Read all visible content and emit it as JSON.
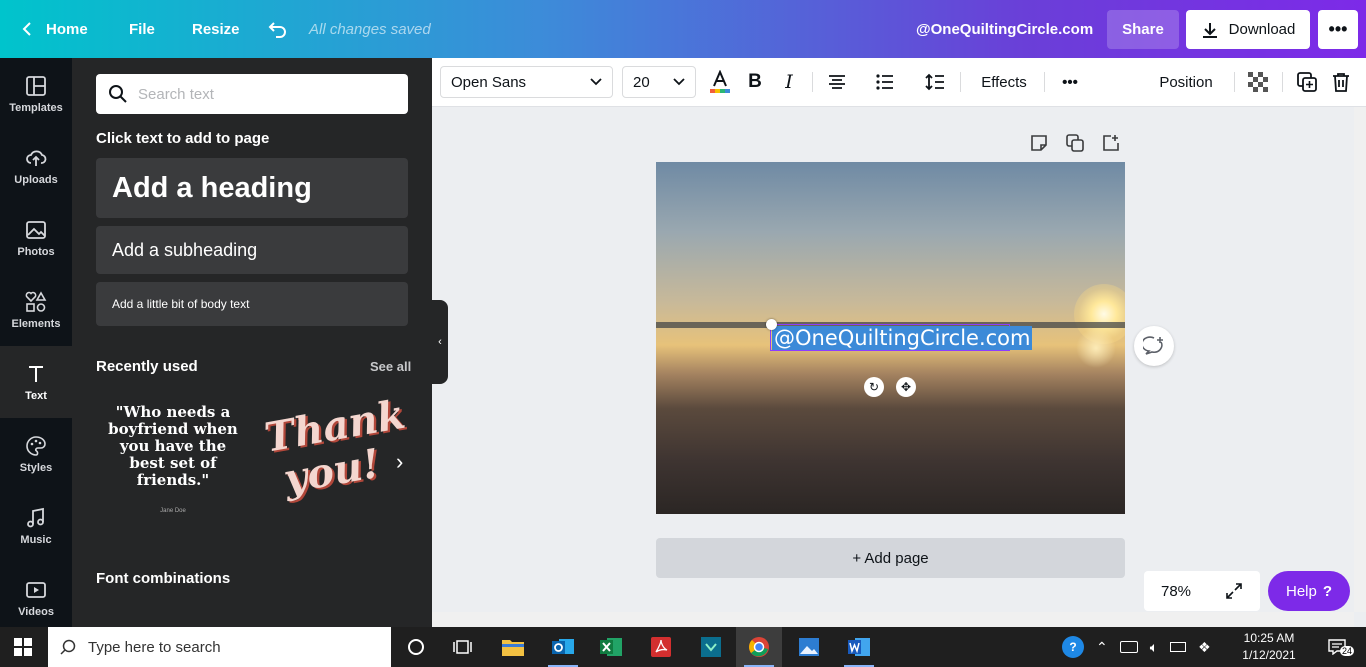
{
  "topbar": {
    "home": "Home",
    "file": "File",
    "resize": "Resize",
    "saved_status": "All changes saved",
    "site": "@OneQuiltingCircle.com",
    "share": "Share",
    "download": "Download",
    "more": "•••"
  },
  "rail": [
    {
      "label": "Templates",
      "icon": "templates-icon"
    },
    {
      "label": "Uploads",
      "icon": "upload-cloud-icon"
    },
    {
      "label": "Photos",
      "icon": "photo-icon"
    },
    {
      "label": "Elements",
      "icon": "shapes-icon"
    },
    {
      "label": "Text",
      "icon": "text-icon"
    },
    {
      "label": "Styles",
      "icon": "palette-icon"
    },
    {
      "label": "Music",
      "icon": "music-icon"
    },
    {
      "label": "Videos",
      "icon": "video-icon"
    }
  ],
  "panel": {
    "search_placeholder": "Search text",
    "click_to_add": "Click text to add to page",
    "heading": "Add a heading",
    "subheading": "Add a subheading",
    "body": "Add a little bit of body text",
    "recently_used": "Recently used",
    "see_all": "See all",
    "thumb1_quote": "\"Who needs a boyfriend when you have the best set of friends.\"",
    "thumb1_author": "Jane Doe",
    "thumb2_text": "Thank you!",
    "font_combinations": "Font combinations"
  },
  "toolbar": {
    "font": "Open Sans",
    "size": "20",
    "effects": "Effects",
    "more": "•••",
    "position": "Position"
  },
  "canvas": {
    "selected_text": "@OneQuiltingCircle.com",
    "add_page": "+ Add page"
  },
  "zoom": {
    "level": "78%"
  },
  "help": {
    "label": "Help",
    "mark": "?"
  },
  "taskbar": {
    "search_placeholder": "Type here to search",
    "time": "10:25 AM",
    "date": "1/12/2021",
    "notifications": "24"
  },
  "colors": {
    "brand_purple": "#7d2ae8",
    "brand_teal": "#00c4cc",
    "selection": "#3c8ad8"
  }
}
